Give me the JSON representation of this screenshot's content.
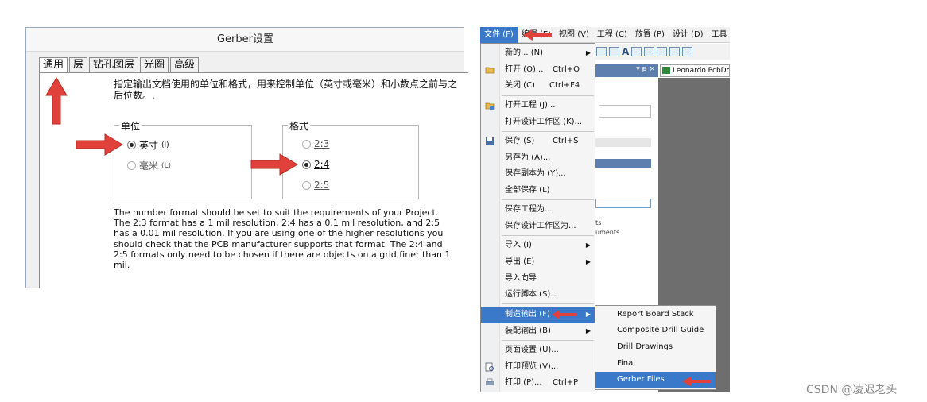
{
  "dialog": {
    "title": "Gerber设置",
    "tabs": [
      "通用",
      "层",
      "钻孔图层",
      "光圈",
      "高级"
    ],
    "description": "指定输出文档使用的单位和格式，用来控制单位（英寸或毫米）和小数点之前与之后位数。.",
    "units": {
      "legend": "单位",
      "options": [
        {
          "label": "英寸",
          "key": "(I)",
          "selected": true
        },
        {
          "label": "毫米",
          "key": "(L)",
          "selected": false
        }
      ]
    },
    "format": {
      "legend": "格式",
      "options": [
        {
          "label": "2:3",
          "selected": false
        },
        {
          "label": "2:4",
          "selected": true
        },
        {
          "label": "2:5",
          "selected": false
        }
      ]
    },
    "note": "The number format should be set to suit the requirements of your Project. The 2:3 format has a 1 mil resolution, 2:4 has a 0.1 mil resolution, and 2:5 has a 0.01 mil resolution. If you are using one of the higher resolutions you should check that the PCB manufacturer supports that format. The 2:4 and 2:5 formats only need to be chosen if there are objects on a grid finer than 1 mil."
  },
  "app": {
    "menubar": [
      "文件 (F)",
      "编辑 (E)",
      "视图 (V)",
      "工程 (C)",
      "放置 (P)",
      "设计 (D)",
      "工具"
    ],
    "document_tab": "Leonardo.PcbDoc",
    "panel_fragments": [
      "ts",
      "uments"
    ],
    "file_menu": [
      {
        "label": "新的... (N)",
        "shortcut": "",
        "submenu": true,
        "icon": ""
      },
      {
        "label": "打开 (O)...",
        "shortcut": "Ctrl+O",
        "submenu": false,
        "icon": "folder-open-icon"
      },
      {
        "label": "关闭 (C)",
        "shortcut": "Ctrl+F4",
        "submenu": false,
        "icon": ""
      },
      {
        "label": "打开工程 (J)...",
        "shortcut": "",
        "submenu": false,
        "icon": "open-project-icon"
      },
      {
        "label": "打开设计工作区 (K)...",
        "shortcut": "",
        "submenu": false,
        "icon": ""
      },
      {
        "label": "保存 (S)",
        "shortcut": "Ctrl+S",
        "submenu": false,
        "icon": "save-icon"
      },
      {
        "label": "另存为 (A)...",
        "shortcut": "",
        "submenu": false,
        "icon": ""
      },
      {
        "label": "保存副本为 (Y)...",
        "shortcut": "",
        "submenu": false,
        "icon": ""
      },
      {
        "label": "全部保存 (L)",
        "shortcut": "",
        "submenu": false,
        "icon": ""
      },
      {
        "label": "保存工程为...",
        "shortcut": "",
        "submenu": false,
        "icon": ""
      },
      {
        "label": "保存设计工作区为...",
        "shortcut": "",
        "submenu": false,
        "icon": ""
      },
      {
        "label": "导入 (I)",
        "shortcut": "",
        "submenu": true,
        "icon": ""
      },
      {
        "label": "导出 (E)",
        "shortcut": "",
        "submenu": true,
        "icon": ""
      },
      {
        "label": "导入向导",
        "shortcut": "",
        "submenu": false,
        "icon": ""
      },
      {
        "label": "运行脚本 (S)...",
        "shortcut": "",
        "submenu": false,
        "icon": ""
      },
      {
        "label": "制造输出 (F)",
        "shortcut": "",
        "submenu": true,
        "icon": ""
      },
      {
        "label": "装配输出 (B)",
        "shortcut": "",
        "submenu": true,
        "icon": ""
      },
      {
        "label": "页面设置 (U)...",
        "shortcut": "",
        "submenu": false,
        "icon": ""
      },
      {
        "label": "打印预览 (V)...",
        "shortcut": "",
        "submenu": false,
        "icon": "print-preview-icon"
      },
      {
        "label": "打印 (P)...",
        "shortcut": "Ctrl+P",
        "submenu": false,
        "icon": "print-icon"
      }
    ],
    "fab_submenu": [
      "Report Board Stack",
      "Composite Drill Guide",
      "Drill Drawings",
      "Final",
      "Gerber Files"
    ]
  },
  "watermark": "CSDN @凌迟老头",
  "colors": {
    "highlight": "#3a78c9",
    "arrow": "#e0413a"
  }
}
